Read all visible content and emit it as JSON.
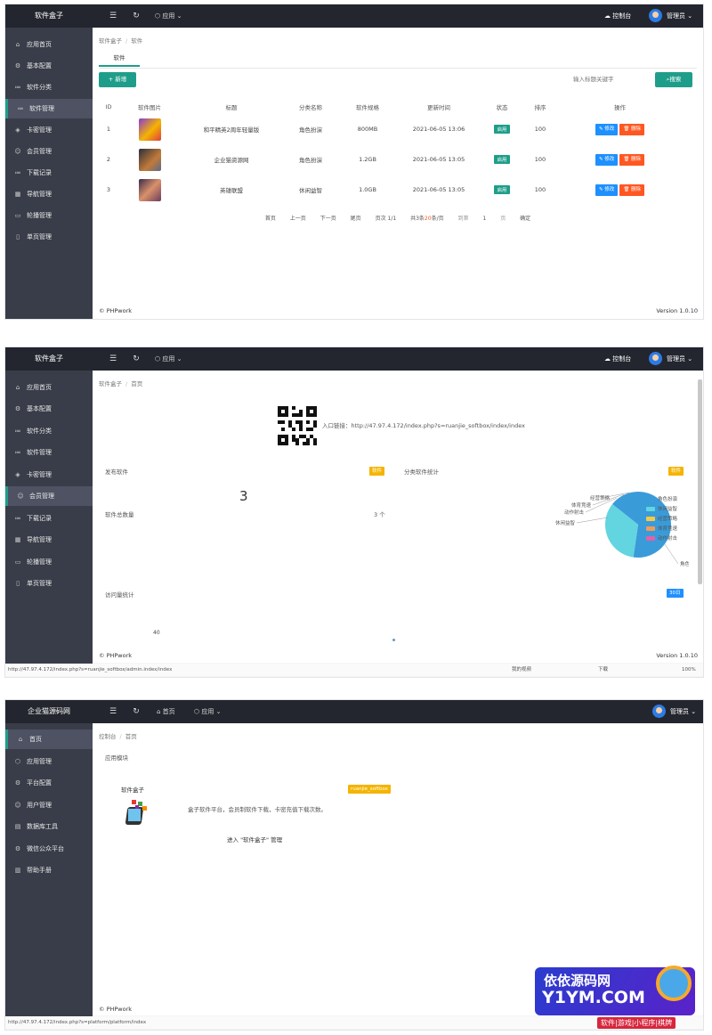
{
  "panel1": {
    "brand": "软件盒子",
    "menu_app": "应用",
    "console": "控制台",
    "admin": "管理员",
    "sidebar": [
      "应用首页",
      "基本配置",
      "软件分类",
      "软件管理",
      "卡密管理",
      "会员管理",
      "下载记录",
      "导航管理",
      "轮播管理",
      "单页管理"
    ],
    "breadcrumb": [
      "软件盒子",
      "软件"
    ],
    "tab": "软件",
    "add_button": "新增",
    "search_placeholder": "输入标题关键字",
    "search_button": "搜索",
    "table": {
      "headers": [
        "ID",
        "软件图片",
        "标题",
        "分类名称",
        "软件规格",
        "更新时间",
        "状态",
        "排序",
        "操作"
      ],
      "rows": [
        {
          "id": "1",
          "title": "和平精英2周年轻量版",
          "category": "角色扮演",
          "size": "800MB",
          "updated": "2021-06-05 13:06",
          "status": "启用",
          "sort": "100"
        },
        {
          "id": "2",
          "title": "企业猫资源网",
          "category": "角色扮演",
          "size": "1.2GB",
          "updated": "2021-06-05 13:05",
          "status": "启用",
          "sort": "100"
        },
        {
          "id": "3",
          "title": "英雄联盟",
          "category": "休闲益智",
          "size": "1.0GB",
          "updated": "2021-06-05 13:05",
          "status": "启用",
          "sort": "100"
        }
      ],
      "edit_label": "修改",
      "delete_label": "删除"
    },
    "pager": {
      "first": "首页",
      "prev": "上一页",
      "next": "下一页",
      "last": "尾页",
      "pages": "页次 1/1",
      "total_prefix": "共3条",
      "per_page_num": "20",
      "total_suffix": "条/页",
      "jump": "到第",
      "page": "1",
      "page_unit": "页",
      "go": "确定"
    },
    "footer_left": "© PHPwork",
    "footer_right": "Version 1.0.10"
  },
  "panel2": {
    "brand": "软件盒子",
    "menu_app": "应用",
    "console": "控制台",
    "admin": "管理员",
    "sidebar": [
      "应用首页",
      "基本配置",
      "软件分类",
      "软件管理",
      "卡密管理",
      "会员管理",
      "下载记录",
      "导航管理",
      "轮播管理",
      "单页管理"
    ],
    "breadcrumb": [
      "软件盒子",
      "首页"
    ],
    "entry_link_label": "入口链接：",
    "entry_link": "http://47.97.4.172/index.php?s=ruanjie_softbox/index/index",
    "publish_title": "发布软件",
    "publish_badge": "软件",
    "publish_count": "3",
    "total_title": "软件总数量",
    "total_value": "3 个",
    "category_stats_title": "分类软件统计",
    "category_badge": "软件",
    "visit_title": "访问量统计",
    "visit_badge": "30日",
    "visit_value": "40",
    "footer_left": "© PHPwork",
    "footer_right": "Version 1.0.10",
    "status_url": "http://47.97.4.172/index.php?s=ruanjie_softbox/admin.index/index",
    "status_right": [
      "我的视频",
      "下载",
      "100%"
    ]
  },
  "chart_data": {
    "type": "pie",
    "title": "",
    "categories": [
      "角色扮演",
      "休闲益智",
      "经营策略",
      "体育竞速",
      "动作射击"
    ],
    "values": [
      2,
      1,
      0,
      0,
      0
    ],
    "colors": [
      "#3a9bd9",
      "#62d5e0",
      "#f7c948",
      "#f09a5c",
      "#e062a8"
    ],
    "legend": "right"
  },
  "panel3": {
    "brand": "企业猫源码网",
    "home": "首页",
    "menu_app": "应用",
    "admin": "管理员",
    "sidebar": [
      "首页",
      "应用管理",
      "平台配置",
      "用户管理",
      "数据库工具",
      "微信公众平台",
      "帮助手册"
    ],
    "breadcrumb": [
      "控制台",
      "首页"
    ],
    "module_title": "应用模块",
    "app_name": "软件盒子",
    "app_tag": "ruanjie_softbox",
    "app_desc": "盒子软件平台，会员制软件下载，卡密充值下载次数。",
    "app_enter": "进入 \"软件盒子\" 管理",
    "footer_left": "© PHPwork",
    "status_url": "http://47.97.4.172/index.php?s=platform/platform/index"
  },
  "watermark": {
    "line1": "依依源码网",
    "line2": "Y1YM.COM",
    "line3": "软件|游戏|小程序|棋牌"
  }
}
